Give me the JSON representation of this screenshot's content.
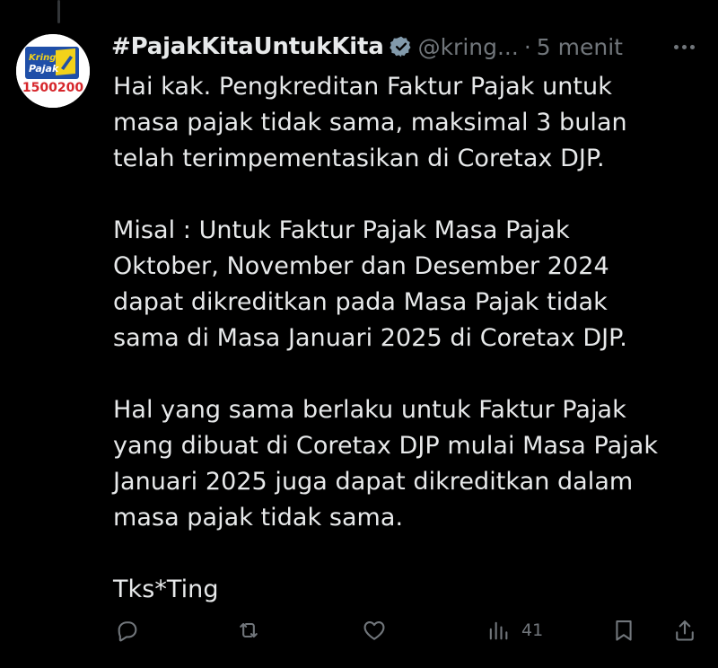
{
  "tweet": {
    "display_name": "#PajakKitaUntukKita",
    "handle": "@kring...",
    "separator": "·",
    "time": "5 menit",
    "avatar": {
      "logo_text": "Kring Pajak",
      "number": "1500200",
      "colors": {
        "blue": "#1f4fa8",
        "yellow": "#f2d21b",
        "red": "#d6262b"
      }
    },
    "text": "Hai kak. Pengkreditan Faktur Pajak untuk\nmasa pajak tidak sama, maksimal 3 bulan\ntelah terimpementasikan di Coretax DJP.\n\nMisal : Untuk Faktur Pajak Masa Pajak\nOktober, November dan Desember 2024\ndapat dikreditkan pada Masa Pajak tidak\nsama di Masa Januari 2025 di Coretax DJP.\n\nHal yang sama berlaku untuk Faktur Pajak\nyang dibuat di Coretax DJP mulai Masa Pajak\nJanuari 2025 juga dapat dikreditkan dalam\nmasa pajak tidak sama.\n\nTks*Ting"
  },
  "actions": {
    "reply_icon": "reply-icon",
    "retweet_icon": "retweet-icon",
    "like_icon": "heart-icon",
    "views_icon": "views-chart-icon",
    "views_count": "41",
    "bookmark_icon": "bookmark-icon",
    "share_icon": "share-icon"
  },
  "colors": {
    "background": "#000000",
    "text": "#e7e9ea",
    "muted": "#71767b",
    "verified": "#829aab"
  }
}
